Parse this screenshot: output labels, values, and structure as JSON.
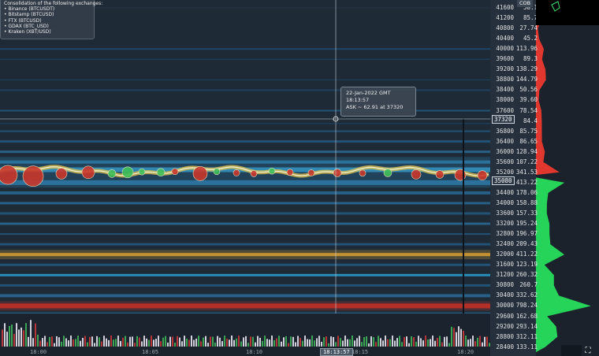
{
  "infobox": {
    "title": "Consolidation of the following exchanges:",
    "exchanges": [
      "• Binance (BTCUSDT)",
      "• Bitstamp (BTCUSD)",
      "• FTX (BTCUSD)",
      "• GDAX (BTC_USD)",
      "• Kraken (XBT/USD)"
    ]
  },
  "tooltip": {
    "date": "22-Jan-2022 GMT",
    "time": "18:13:57",
    "ask": "ASK ~ 62.91 at 37320"
  },
  "price_axis": {
    "labels": [
      "41600",
      "41200",
      "40800",
      "40400",
      "40000",
      "39600",
      "39200",
      "38800",
      "38400",
      "38000",
      "37600",
      "37200",
      "36800",
      "36400",
      "36000",
      "35600",
      "35200",
      "34800",
      "34400",
      "34000",
      "33600",
      "33200",
      "32800",
      "32400",
      "32000",
      "31600",
      "31200",
      "30800",
      "30400",
      "30000",
      "29600",
      "29200",
      "28800",
      "28400"
    ],
    "cursor_price": "37320",
    "last_price": "35080"
  },
  "cob": {
    "header": "COB",
    "values": [
      "58.1",
      "85.7",
      "27.74",
      "45.2",
      "113.96",
      "89.3",
      "138.29",
      "144.79",
      "50.56",
      "39.60",
      "78.54",
      "84.4",
      "85.75",
      "86.65",
      "128.94",
      "107.22",
      "341.53",
      "413.22",
      "178.06",
      "158.88",
      "157.33",
      "195.24",
      "196.97",
      "209.43",
      "411.22",
      "123.19",
      "260.32",
      "260.7",
      "332.62",
      "798.24",
      "162.68",
      "293.14",
      "312.11",
      "133.11"
    ],
    "ask_color": "#e0372f",
    "bid_color": "#27d45a"
  },
  "time_axis": {
    "labels": [
      "18:00",
      "18:05",
      "18:10",
      "18:15",
      "18:20"
    ],
    "cursor_time": "18:13:57"
  },
  "colors": {
    "background": "#1d2733",
    "heat_low": "#1d4f73",
    "heat_mid": "#2aa6d6",
    "heat_high": "#f2c23a",
    "heat_max": "#d9342b"
  },
  "icons": [
    "expand-icon",
    "crosshair-icon"
  ]
}
